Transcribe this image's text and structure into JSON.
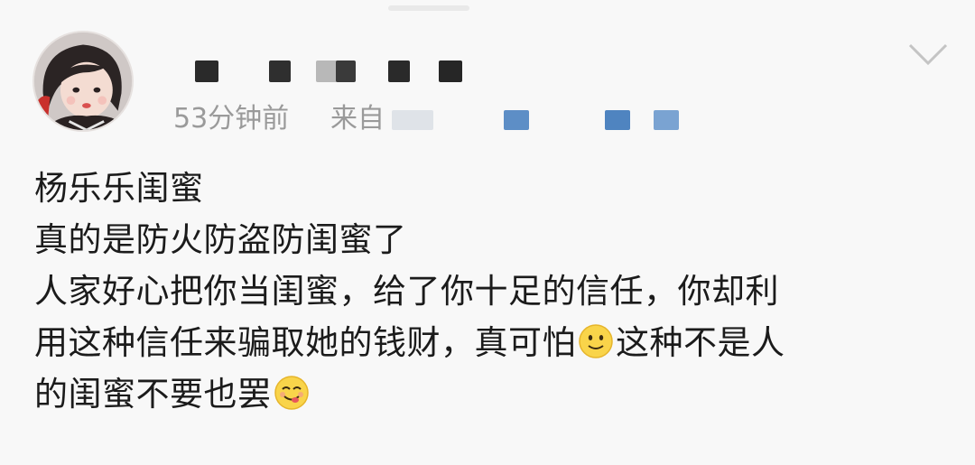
{
  "post": {
    "meta": {
      "time_ago": "53分钟前",
      "from_label": "来自"
    },
    "content_lines": [
      "杨乐乐闺蜜",
      "真的是防火防盗防闺蜜了",
      "人家好心把你当闺蜜，给了你十足的信任，你却利",
      "用这种信任来骗取她的钱财，真可怕",
      "这种不是人",
      "的闺蜜不要也罢"
    ],
    "emojis": [
      "slight-smile-emoji",
      "yummy-emoji"
    ],
    "icons": {
      "more": "chevron-down-icon"
    },
    "colors": {
      "meta_text": "#9a9a9a",
      "content_text": "#1b1b1b",
      "source_blur": "#5f8fc4"
    }
  }
}
